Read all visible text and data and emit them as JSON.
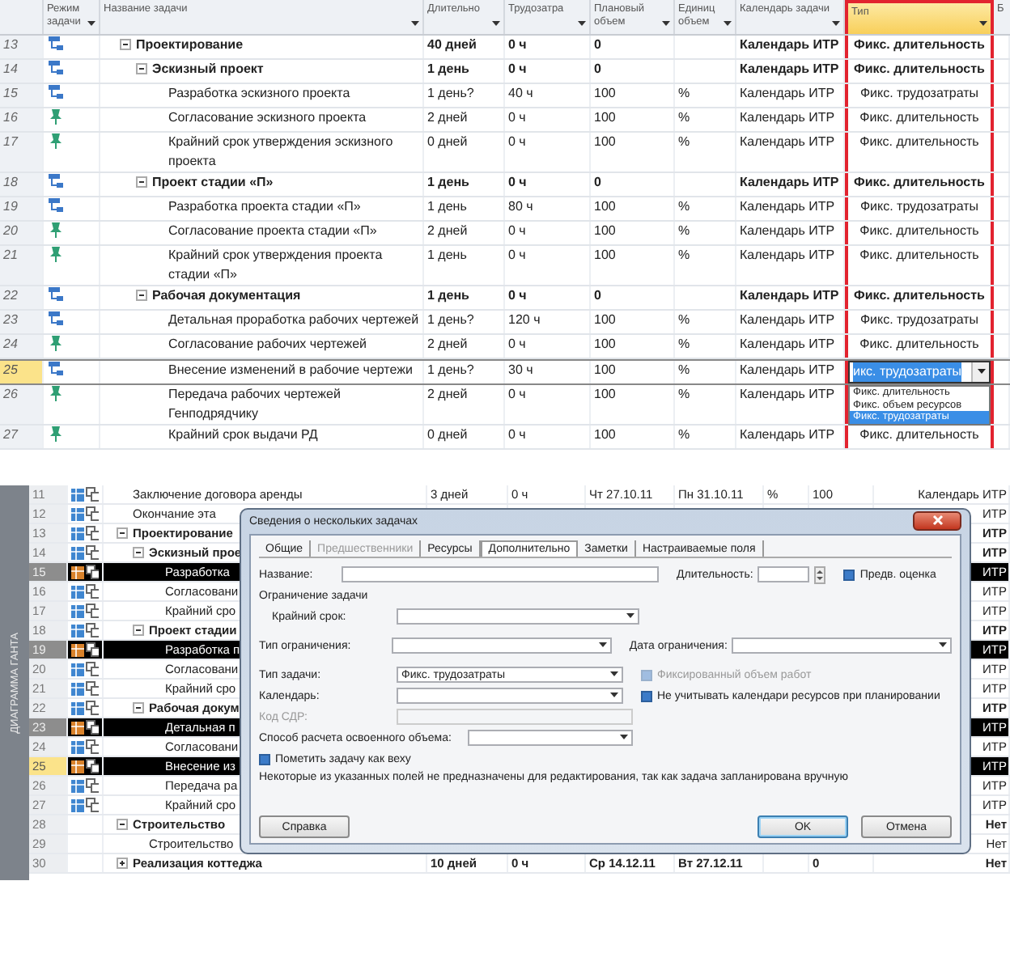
{
  "top": {
    "columns": [
      {
        "label": "Режим задачи",
        "selected": false
      },
      {
        "label": "Название задачи",
        "selected": false
      },
      {
        "label": "Длительно",
        "selected": false
      },
      {
        "label": "Трудозатра",
        "selected": false
      },
      {
        "label": "Плановый объем",
        "selected": false
      },
      {
        "label": "Единиц объем",
        "selected": false
      },
      {
        "label": "Календарь задачи",
        "selected": false
      },
      {
        "label": "Тип",
        "selected": true
      },
      {
        "label": "Б",
        "selected": false
      }
    ],
    "tasks": [
      {
        "num": "13",
        "kind": "auto",
        "name": "Проектирование",
        "expanded": true,
        "selected": false,
        "duration": "40 дней",
        "work": "0 ч",
        "planned": "0",
        "calendar": "Календарь ИТР",
        "type": "Фикс. длительность",
        "children": [
          {
            "num": "14",
            "kind": "auto",
            "name": "Эскизный проект",
            "expanded": true,
            "selected": false,
            "duration": "1 день",
            "work": "0 ч",
            "planned": "0",
            "calendar": "Календарь ИТР",
            "type": "Фикс. длительность",
            "children": [
              {
                "num": "15",
                "kind": "auto",
                "name": "Разработка эскизного проекта",
                "selected": false,
                "duration": "1 день?",
                "work": "40 ч",
                "planned": "100",
                "units": "%",
                "calendar": "Календарь ИТР",
                "type": "Фикс. трудозатраты"
              },
              {
                "num": "16",
                "kind": "manual",
                "name": "Согласование эскизного проекта",
                "selected": false,
                "duration": "2 дней",
                "work": "0 ч",
                "planned": "100",
                "units": "%",
                "calendar": "Календарь ИТР",
                "type": "Фикс. длительность"
              },
              {
                "num": "17",
                "kind": "manual",
                "name": "Крайний срок утверждения эскизного проекта",
                "selected": false,
                "duration": "0 дней",
                "work": "0 ч",
                "planned": "100",
                "units": "%",
                "calendar": "Календарь ИТР",
                "type": "Фикс. длительность"
              }
            ]
          },
          {
            "num": "18",
            "kind": "auto",
            "name": "Проект стадии «П»",
            "expanded": true,
            "selected": false,
            "duration": "1 день",
            "work": "0 ч",
            "planned": "0",
            "calendar": "Календарь ИТР",
            "type": "Фикс. длительность",
            "children": [
              {
                "num": "19",
                "kind": "auto",
                "name": "Разработка проекта стадии «П»",
                "selected": false,
                "duration": "1 день",
                "work": "80 ч",
                "planned": "100",
                "units": "%",
                "calendar": "Календарь ИТР",
                "type": "Фикс. трудозатраты"
              },
              {
                "num": "20",
                "kind": "manual",
                "name": "Согласование проекта стадии «П»",
                "selected": false,
                "duration": "2 дней",
                "work": "0 ч",
                "planned": "100",
                "units": "%",
                "calendar": "Календарь ИТР",
                "type": "Фикс. длительность"
              },
              {
                "num": "21",
                "kind": "manual",
                "name": "Крайний срок утверждения проекта стадии «П»",
                "selected": false,
                "duration": "1 день",
                "work": "0 ч",
                "planned": "100",
                "units": "%",
                "calendar": "Календарь ИТР",
                "type": "Фикс. длительность"
              }
            ]
          },
          {
            "num": "22",
            "kind": "auto",
            "name": "Рабочая документация",
            "expanded": true,
            "selected": false,
            "duration": "1 день",
            "work": "0 ч",
            "planned": "0",
            "calendar": "Календарь ИТР",
            "type": "Фикс. длительность",
            "children": [
              {
                "num": "23",
                "kind": "auto",
                "name": "Детальная проработка рабочих чертежей",
                "selected": false,
                "duration": "1 день?",
                "work": "120 ч",
                "planned": "100",
                "units": "%",
                "calendar": "Календарь ИТР",
                "type": "Фикс. трудозатраты"
              },
              {
                "num": "24",
                "kind": "manual",
                "name": "Согласование рабочих чертежей",
                "selected": false,
                "duration": "2 дней",
                "work": "0 ч",
                "planned": "100",
                "units": "%",
                "calendar": "Календарь ИТР",
                "type": "Фикс. длительность"
              },
              {
                "num": "25",
                "kind": "auto",
                "name": "Внесение изменений в рабочие чертежи",
                "selected": true,
                "duration": "1 день?",
                "work": "30 ч",
                "planned": "100",
                "units": "%",
                "calendar": "Календарь ИТР",
                "editor": {
                  "value": "икс. трудозатраты",
                  "options": [
                    {
                      "label": "Фикс. длительность",
                      "selected": false
                    },
                    {
                      "label": "Фикс. объем ресурсов",
                      "selected": false
                    },
                    {
                      "label": "Фикс. трудозатраты",
                      "selected": true
                    }
                  ]
                }
              },
              {
                "num": "26",
                "kind": "manual",
                "name": "Передача рабочих чертежей Генподрядчику",
                "selected": false,
                "duration": "2 дней",
                "work": "0 ч",
                "planned": "100",
                "units": "%",
                "calendar": "Календарь ИТР"
              },
              {
                "num": "27",
                "kind": "manual",
                "name": "Крайний срок выдачи РД",
                "selected": false,
                "duration": "0 дней",
                "work": "0 ч",
                "planned": "100",
                "units": "%",
                "calendar": "Календарь ИТР",
                "type": "Фикс. длительность"
              }
            ]
          }
        ]
      }
    ]
  },
  "gantt": {
    "view_label": "ДИАГРАММА ГАНТА",
    "rows": [
      {
        "num": "11",
        "icons": true,
        "name": "Заключение договора аренды",
        "selected": false,
        "active": false,
        "duration": "3 дней",
        "work": "0 ч",
        "start": "Чт 27.10.11",
        "finish": "Пн 31.10.11",
        "units": "%",
        "planned": "100",
        "last": "Календарь ИТР"
      },
      {
        "num": "12",
        "icons": true,
        "name": "Окончание эта",
        "selected": false,
        "active": false,
        "last": "ИТР"
      },
      {
        "num": "13",
        "icons": true,
        "name": "Проектирование",
        "expanded": true,
        "selected": false,
        "active": false,
        "last": "ИТР",
        "children": [
          {
            "num": "14",
            "icons": true,
            "name": "Эскизный прое",
            "expanded": true,
            "selected": false,
            "active": false,
            "last": "ИТР",
            "children": [
              {
                "num": "15",
                "icons": true,
                "name": "Разработка",
                "selected": true,
                "active": false,
                "last": "ИТР"
              },
              {
                "num": "16",
                "icons": true,
                "name": "Согласовани",
                "selected": false,
                "active": false,
                "last": "ИТР"
              },
              {
                "num": "17",
                "icons": true,
                "name": "Крайний сро",
                "selected": false,
                "active": false,
                "last": "ИТР"
              }
            ]
          },
          {
            "num": "18",
            "icons": true,
            "name": "Проект стадии",
            "expanded": true,
            "selected": false,
            "active": false,
            "last": "ИТР",
            "children": [
              {
                "num": "19",
                "icons": true,
                "name": "Разработка п",
                "selected": true,
                "active": false,
                "last": "ИТР"
              },
              {
                "num": "20",
                "icons": true,
                "name": "Согласовани",
                "selected": false,
                "active": false,
                "last": "ИТР"
              },
              {
                "num": "21",
                "icons": true,
                "name": "Крайний сро",
                "selected": false,
                "active": false,
                "last": "ИТР"
              }
            ]
          },
          {
            "num": "22",
            "icons": true,
            "name": "Рабочая докум",
            "expanded": true,
            "selected": false,
            "active": false,
            "last": "ИТР",
            "children": [
              {
                "num": "23",
                "icons": true,
                "name": "Детальная п",
                "selected": true,
                "active": false,
                "last": "ИТР"
              },
              {
                "num": "24",
                "icons": true,
                "name": "Согласовани",
                "selected": false,
                "active": false,
                "last": "ИТР"
              },
              {
                "num": "25",
                "icons": true,
                "name": "Внесение из",
                "selected": true,
                "active": true,
                "last": "ИТР"
              },
              {
                "num": "26",
                "icons": true,
                "name": "Передача ра",
                "selected": false,
                "active": false,
                "last": "ИТР"
              },
              {
                "num": "27",
                "icons": true,
                "name": "Крайний сро",
                "selected": false,
                "active": false,
                "last": "ИТР"
              }
            ]
          }
        ]
      },
      {
        "num": "28",
        "icons": false,
        "name": "Строительство",
        "expanded": true,
        "selected": false,
        "active": false,
        "last": "Нет",
        "children": [
          {
            "num": "29",
            "icons": false,
            "name": "Строительство",
            "selected": false,
            "active": false,
            "last": "Нет"
          }
        ]
      },
      {
        "num": "30",
        "icons": false,
        "name": "Реализация коттеджа",
        "expanded": false,
        "selected": false,
        "active": false,
        "duration": "10 дней",
        "work": "0 ч",
        "start": "Ср 14.12.11",
        "finish": "Вт 27.12.11",
        "planned": "0",
        "last": "Нет"
      }
    ]
  },
  "dialog": {
    "title": "Сведения о нескольких задачах",
    "tabs": [
      {
        "label": "Общие",
        "selected": false,
        "disabled": false
      },
      {
        "label": "Предшественники",
        "selected": false,
        "disabled": true
      },
      {
        "label": "Ресурсы",
        "selected": false,
        "disabled": false
      },
      {
        "label": "Дополнительно",
        "selected": true,
        "disabled": false
      },
      {
        "label": "Заметки",
        "selected": false,
        "disabled": false
      },
      {
        "label": "Настраиваемые поля",
        "selected": false,
        "disabled": false
      }
    ],
    "name_field": {
      "label": "Название:"
    },
    "duration_field": {
      "label": "Длительность:"
    },
    "estimate_checkbox": {
      "label": "Предв. оценка",
      "checked": true,
      "disabled": false
    },
    "constraint_group": "Ограничение задачи",
    "deadline_field": {
      "label": "Крайний срок:"
    },
    "constraint_type_field": {
      "label": "Тип ограничения:"
    },
    "constraint_date_field": {
      "label": "Дата ограничения:"
    },
    "task_type_field": {
      "label": "Тип задачи:",
      "value": "Фикс. трудозатраты"
    },
    "effort_driven_checkbox": {
      "label": "Фиксированный объем работ",
      "checked": true,
      "disabled": true
    },
    "calendar_field": {
      "label": "Календарь:"
    },
    "ignore_calendars_checkbox": {
      "label": "Не учитывать календари ресурсов при планировании",
      "checked": true,
      "disabled": false
    },
    "wbs_field": {
      "label": "Код СДР:",
      "disabled": true
    },
    "earned_value_field": {
      "label": "Способ расчета освоенного объема:"
    },
    "milestone_checkbox": {
      "label": "Пометить задачу как веху",
      "checked": true,
      "disabled": false
    },
    "note": "Некоторые из указанных полей не предназначены для редактирования, так как задача запланирована вручную",
    "buttons": [
      {
        "label": "Справка",
        "default": false
      },
      {
        "label": "OK",
        "default": true
      },
      {
        "label": "Отмена",
        "default": false
      }
    ]
  }
}
